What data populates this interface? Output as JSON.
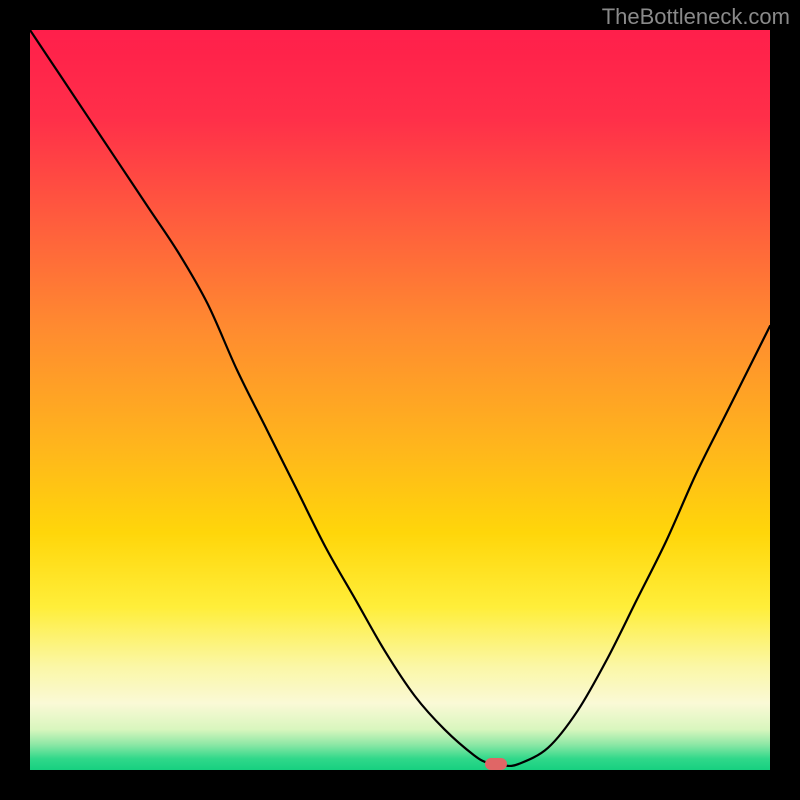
{
  "watermark": "TheBottleneck.com",
  "marker": {
    "x_frac": 0.63,
    "y_frac": 0.992,
    "w": 22,
    "h": 12
  },
  "gradient_stops": [
    {
      "pos": 0.0,
      "color": "#ff1f4b"
    },
    {
      "pos": 0.12,
      "color": "#ff2f49"
    },
    {
      "pos": 0.25,
      "color": "#ff5a3e"
    },
    {
      "pos": 0.4,
      "color": "#ff8a30"
    },
    {
      "pos": 0.55,
      "color": "#ffb21e"
    },
    {
      "pos": 0.68,
      "color": "#ffd60a"
    },
    {
      "pos": 0.78,
      "color": "#ffee3a"
    },
    {
      "pos": 0.86,
      "color": "#fbf7a6"
    },
    {
      "pos": 0.91,
      "color": "#faf9d6"
    },
    {
      "pos": 0.945,
      "color": "#d9f6be"
    },
    {
      "pos": 0.965,
      "color": "#8fe8a6"
    },
    {
      "pos": 0.985,
      "color": "#2fd88a"
    },
    {
      "pos": 1.0,
      "color": "#17d080"
    }
  ],
  "chart_data": {
    "type": "line",
    "title": "",
    "xlabel": "",
    "ylabel": "",
    "xlim": [
      0,
      100
    ],
    "ylim": [
      0,
      100
    ],
    "x": [
      0,
      4,
      8,
      12,
      16,
      20,
      24,
      28,
      32,
      36,
      40,
      44,
      48,
      52,
      56,
      60,
      62,
      64,
      66,
      70,
      74,
      78,
      82,
      86,
      90,
      94,
      98,
      100
    ],
    "y": [
      100,
      94,
      88,
      82,
      76,
      70,
      63,
      54,
      46,
      38,
      30,
      23,
      16,
      10,
      5.5,
      2,
      0.9,
      0.6,
      0.8,
      3,
      8,
      15,
      23,
      31,
      40,
      48,
      56,
      60
    ],
    "annotations": [
      {
        "text": "TheBottleneck.com",
        "position": "top-right"
      }
    ]
  }
}
